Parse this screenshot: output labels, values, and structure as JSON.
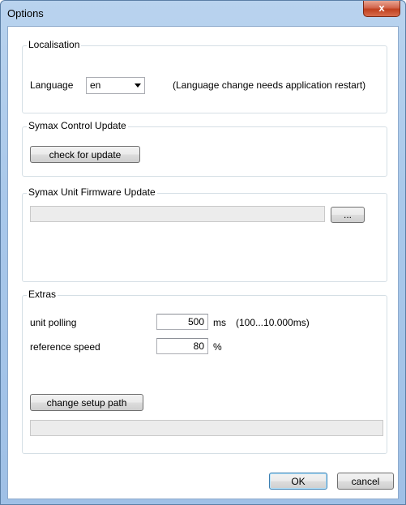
{
  "window": {
    "title": "Options",
    "close_label": "x"
  },
  "localisation": {
    "legend": "Localisation",
    "language_label": "Language",
    "language_value": "en",
    "note": "(Language change needs application restart)"
  },
  "control_update": {
    "legend": "Symax Control Update",
    "check_button": "check for update"
  },
  "firmware_update": {
    "legend": "Symax Unit Firmware Update",
    "path_value": "",
    "browse_button": "..."
  },
  "extras": {
    "legend": "Extras",
    "unit_polling_label": "unit polling",
    "unit_polling_value": "500",
    "unit_polling_unit": "ms",
    "unit_polling_range": "(100...10.000ms)",
    "reference_speed_label": "reference speed",
    "reference_speed_value": "80",
    "reference_speed_unit": "%",
    "change_setup_button": "change setup path",
    "setup_path_value": ""
  },
  "footer": {
    "ok_button": "OK",
    "cancel_button": "cancel"
  }
}
